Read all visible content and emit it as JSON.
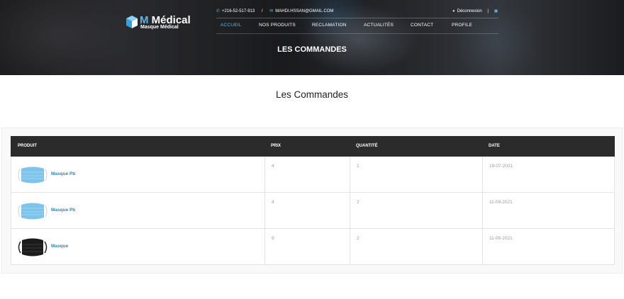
{
  "brand": {
    "title_m": "M",
    "title_rest": " Médical",
    "subtitle": "Masque Médical",
    "accent": "#5fb4e8"
  },
  "topbar": {
    "phone": "+216-52-517-913",
    "phone_icon": "phone-icon",
    "separator": "/",
    "email": "MAHDI.HSSAN@GMAIL.COM",
    "email_icon": "envelope-icon",
    "logout": "Déconnexion",
    "logout_icon": "lock-icon",
    "cart_icon": "cart-icon"
  },
  "nav": {
    "items": [
      {
        "label": "ACCUEIL",
        "active": true
      },
      {
        "label": "NOS PRODUITS",
        "active": false
      },
      {
        "label": "RECLAMATION",
        "active": false
      },
      {
        "label": "ACTUALITÉS",
        "active": false
      },
      {
        "label": "CONTACT",
        "active": false
      },
      {
        "label": "PROFILE",
        "active": false
      }
    ]
  },
  "hero": {
    "title": "LES COMMANDES"
  },
  "section": {
    "title": "Les Commandes"
  },
  "table": {
    "headers": {
      "product": "PRODUIT",
      "price": "PRIX",
      "quantity": "QUANTITÉ",
      "date": "DATE"
    },
    "rows": [
      {
        "product": "Masque Pb",
        "price": "4",
        "quantity": "1",
        "date": "19-07-2021",
        "image": "blue-mask"
      },
      {
        "product": "Masque Pb",
        "price": "4",
        "quantity": "2",
        "date": "11-09-2021",
        "image": "blue-mask"
      },
      {
        "product": "Masque",
        "price": "9",
        "quantity": "2",
        "date": "11-09-2021",
        "image": "black-mask"
      }
    ]
  }
}
